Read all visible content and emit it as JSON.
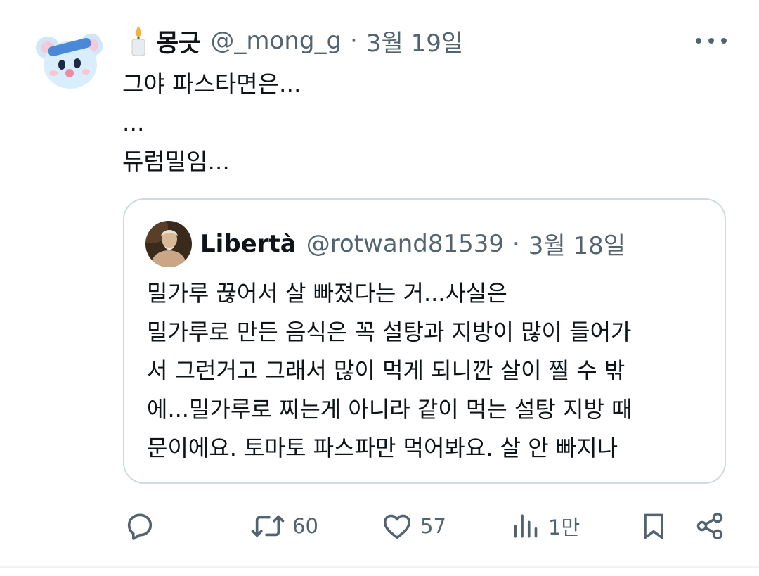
{
  "tweet": {
    "display_name": "몽긋",
    "handle": "@_mong_g",
    "separator": "·",
    "date": "3월 19일",
    "lines": [
      "그야 파스타면은...",
      "...",
      "듀럼밀임..."
    ]
  },
  "quote": {
    "display_name": "Libertà",
    "handle": "@rotwand81539",
    "separator": "·",
    "date": "3월 18일",
    "lines": [
      "밀가루 끊어서 살 빠졌다는 거...사실은",
      "밀가루로 만든 음식은 꼭 설탕과 지방이 많이 들어가",
      "서 그런거고 그래서 많이 먹게 되니깐 살이 찔 수 밖",
      "에...밀가루로 찌는게 아니라 같이 먹는 설탕 지방 때",
      "문이에요. 토마토 파스파만 먹어봐요. 살 안 빠지나"
    ]
  },
  "actions": {
    "reply": {
      "icon": "reply-icon",
      "count": ""
    },
    "retweet": {
      "icon": "retweet-icon",
      "count": "60"
    },
    "like": {
      "icon": "heart-icon",
      "count": "57"
    },
    "views": {
      "icon": "views-icon",
      "count": "1만"
    },
    "bookmark": {
      "icon": "bookmark-icon"
    },
    "share": {
      "icon": "share-icon"
    }
  },
  "colors": {
    "text": "#0f1419",
    "secondary": "#536471",
    "border": "#cfd9de",
    "avatar_blue": "#a8d4f5"
  }
}
